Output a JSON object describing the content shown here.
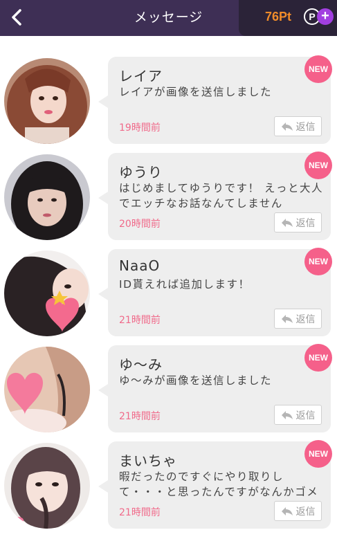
{
  "header": {
    "title": "メッセージ",
    "points": "76Pt",
    "points_icon": "P",
    "plus_icon": "+"
  },
  "reply_label": "返信",
  "badge_label": "NEW",
  "messages": [
    {
      "name": "レイア",
      "preview": "レイアが画像を送信しました",
      "time": "19時間前",
      "avatar_palette": "warm-brown"
    },
    {
      "name": "ゆうり",
      "preview": "はじめましてゆうりです！ えっと大人でエッチなお話なんてしません",
      "time": "20時間前",
      "avatar_palette": "dark-hair"
    },
    {
      "name": "NaaO",
      "preview": "ID貰えれば追加します！",
      "time": "21時間前",
      "avatar_palette": "heart-overlay"
    },
    {
      "name": "ゆ〜み",
      "preview": "ゆ〜みが画像を送信しました",
      "time": "21時間前",
      "avatar_palette": "heart-overlay-skin"
    },
    {
      "name": "まいちゃ",
      "preview": "暇だったのですぐにやり取りして・・・と思ったんですがなんかゴメンなさ",
      "time": "21時間前",
      "avatar_palette": "light-pink"
    }
  ]
}
